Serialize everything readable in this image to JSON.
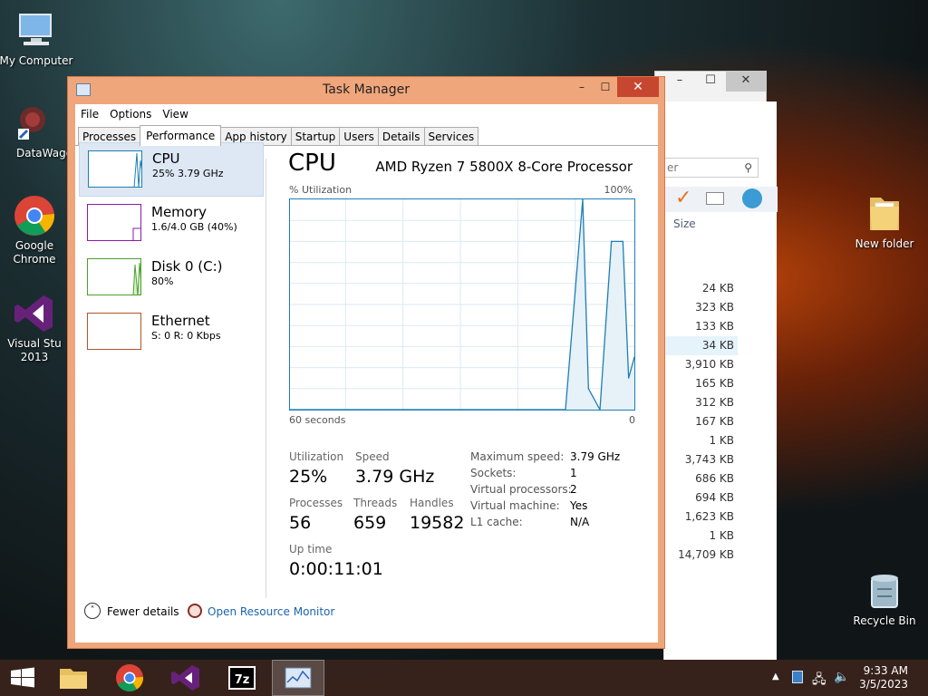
{
  "desktop": {
    "icons": [
      {
        "label": "My Computer"
      },
      {
        "label": "DataWago"
      },
      {
        "label": "Google Chrome"
      },
      {
        "label": "Visual Stu 2013"
      },
      {
        "label": "New folder"
      },
      {
        "label": "Recycle Bin"
      }
    ]
  },
  "explorer": {
    "search_placeholder": "er",
    "size_header": "Size",
    "sizes": [
      "24 KB",
      "323 KB",
      "133 KB",
      "34 KB",
      "3,910 KB",
      "165 KB",
      "312 KB",
      "167 KB",
      "1 KB",
      "3,743 KB",
      "686 KB",
      "694 KB",
      "1,623 KB",
      "1 KB",
      "14,709 KB"
    ]
  },
  "task_manager": {
    "title": "Task Manager",
    "menu": [
      "File",
      "Options",
      "View"
    ],
    "tabs": [
      "Processes",
      "Performance",
      "App history",
      "Startup",
      "Users",
      "Details",
      "Services"
    ],
    "active_tab": "Performance",
    "sidebar": [
      {
        "name": "CPU",
        "sub": "25% 3.79 GHz",
        "color": "#1d7fb3"
      },
      {
        "name": "Memory",
        "sub": "1.6/4.0 GB (40%)",
        "color": "#8b1aa6"
      },
      {
        "name": "Disk 0 (C:)",
        "sub": "80%",
        "color": "#4aa12a"
      },
      {
        "name": "Ethernet",
        "sub": "S: 0 R: 0 Kbps",
        "color": "#b0562a"
      }
    ],
    "cpu": {
      "title": "CPU",
      "processor": "AMD Ryzen 7 5800X 8-Core Processor",
      "util_label": "% Utilization",
      "util_max": "100%",
      "axis_left": "60 seconds",
      "axis_right": "0",
      "utilization_label": "Utilization",
      "utilization": "25%",
      "speed_label": "Speed",
      "speed": "3.79 GHz",
      "processes_label": "Processes",
      "processes": "56",
      "threads_label": "Threads",
      "threads": "659",
      "handles_label": "Handles",
      "handles": "19582",
      "uptime_label": "Up time",
      "uptime": "0:00:11:01",
      "details": [
        {
          "label": "Maximum speed:",
          "value": "3.79 GHz"
        },
        {
          "label": "Sockets:",
          "value": "1"
        },
        {
          "label": "Virtual processors:",
          "value": "2"
        },
        {
          "label": "Virtual machine:",
          "value": "Yes"
        },
        {
          "label": "L1 cache:",
          "value": "N/A"
        }
      ]
    },
    "footer": {
      "fewer_details": "Fewer details",
      "open_resource_monitor": "Open Resource Monitor"
    }
  },
  "chart_data": {
    "type": "line",
    "title": "",
    "xlabel": "",
    "ylabel": "% Utilization",
    "xlim": [
      60,
      0
    ],
    "ylim": [
      0,
      100
    ],
    "series": [
      {
        "values_seconds_ago": [
          60,
          55,
          50,
          45,
          40,
          35,
          30,
          25,
          20,
          15,
          12,
          9,
          8,
          6,
          4,
          2,
          1,
          0
        ],
        "values": [
          0,
          0,
          0,
          0,
          0,
          0,
          0,
          0,
          0,
          0,
          0,
          100,
          10,
          0,
          80,
          80,
          15,
          25
        ]
      }
    ]
  },
  "taskbar": {
    "apps": [
      "File Explorer",
      "Google Chrome",
      "Visual Studio",
      "7-Zip",
      "Task Manager"
    ],
    "time": "9:33 AM",
    "date": "3/5/2023"
  }
}
